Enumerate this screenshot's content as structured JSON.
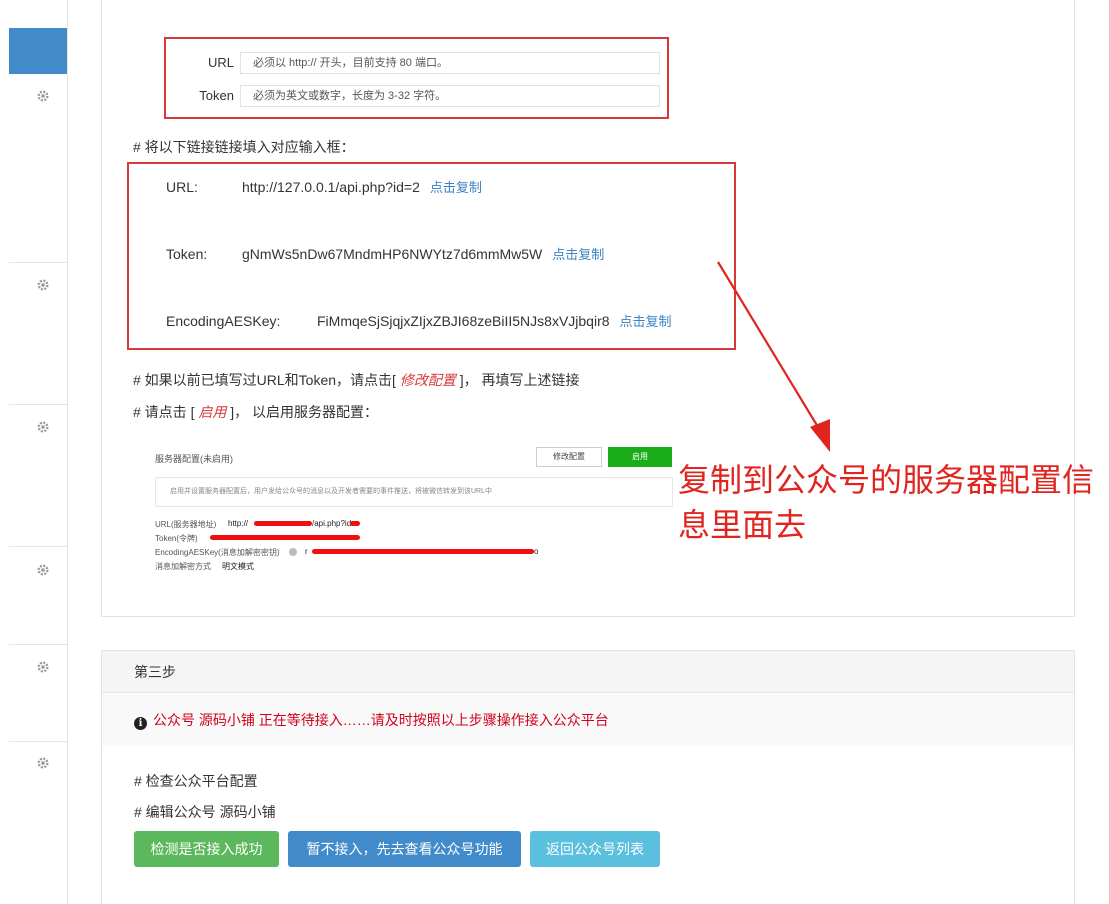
{
  "form": {
    "url_label": "URL",
    "url_hint": "必须以 http:// 开头，目前支持 80 端口。",
    "token_label": "Token",
    "token_hint": "必须为英文或数字，长度为 3-32 字符。"
  },
  "instructions": {
    "fill_links": "# 将以下链接链接填入对应输入框：",
    "modify_prefix": "# 如果以前已填写过URL和Token，请点击[ ",
    "modify_link": "修改配置",
    "modify_suffix": " ]， 再填写上述链接",
    "enable_prefix": "# 请点击 [ ",
    "enable_link": "启用",
    "enable_suffix": " ]， 以启用服务器配置："
  },
  "links": {
    "url_key": "URL:",
    "url_value": "http://127.0.0.1/api.php?id=2",
    "token_key": "Token:",
    "token_value": "gNmWs5nDw67MndmHP6NWYtz7d6mmMw5W",
    "aes_key": "EncodingAESKey:",
    "aes_value": "FiMmqeSjSjqjxZIjxZBJI68zeBiII5NJs8xVJjbqir8",
    "copy_label": "点击复制"
  },
  "embedded_screenshot": {
    "title": "服务器配置(未启用)",
    "modify_button": "修改配置",
    "enable_button": "启用",
    "note": "启用并设置服务器配置后，用户发给公众号的消息以及开发者需要的事件推送，将被微信转发到该URL中",
    "url_label": "URL(服务器地址)",
    "url_prefix": "http://",
    "url_mid": "/api.php?id=",
    "token_label": "Token(令牌)",
    "aes_label": "EncodingAESKey(消息加解密密钥)",
    "aes_prefix": "r",
    "aes_suffix": "o",
    "mode_label": "消息加解密方式",
    "mode_value": "明文模式"
  },
  "annotation": "复制到公众号的服务器配置信息里面去",
  "step3": {
    "title": "第三步",
    "alert": "公众号 源码小铺 正在等待接入……请及时按照以上步骤操作接入公众平台",
    "check": "# 检查公众平台配置",
    "edit": "# 编辑公众号 源码小铺",
    "btn_check": "检测是否接入成功",
    "btn_skip": "暂不接入，先去查看公众号功能",
    "btn_back": "返回公众号列表"
  },
  "colors": {
    "highlight_border": "#d9383a",
    "link": "#3b83c4",
    "annotation": "#e0241f",
    "success": "#5cb85c",
    "primary": "#428bca",
    "info": "#5bc0de"
  }
}
